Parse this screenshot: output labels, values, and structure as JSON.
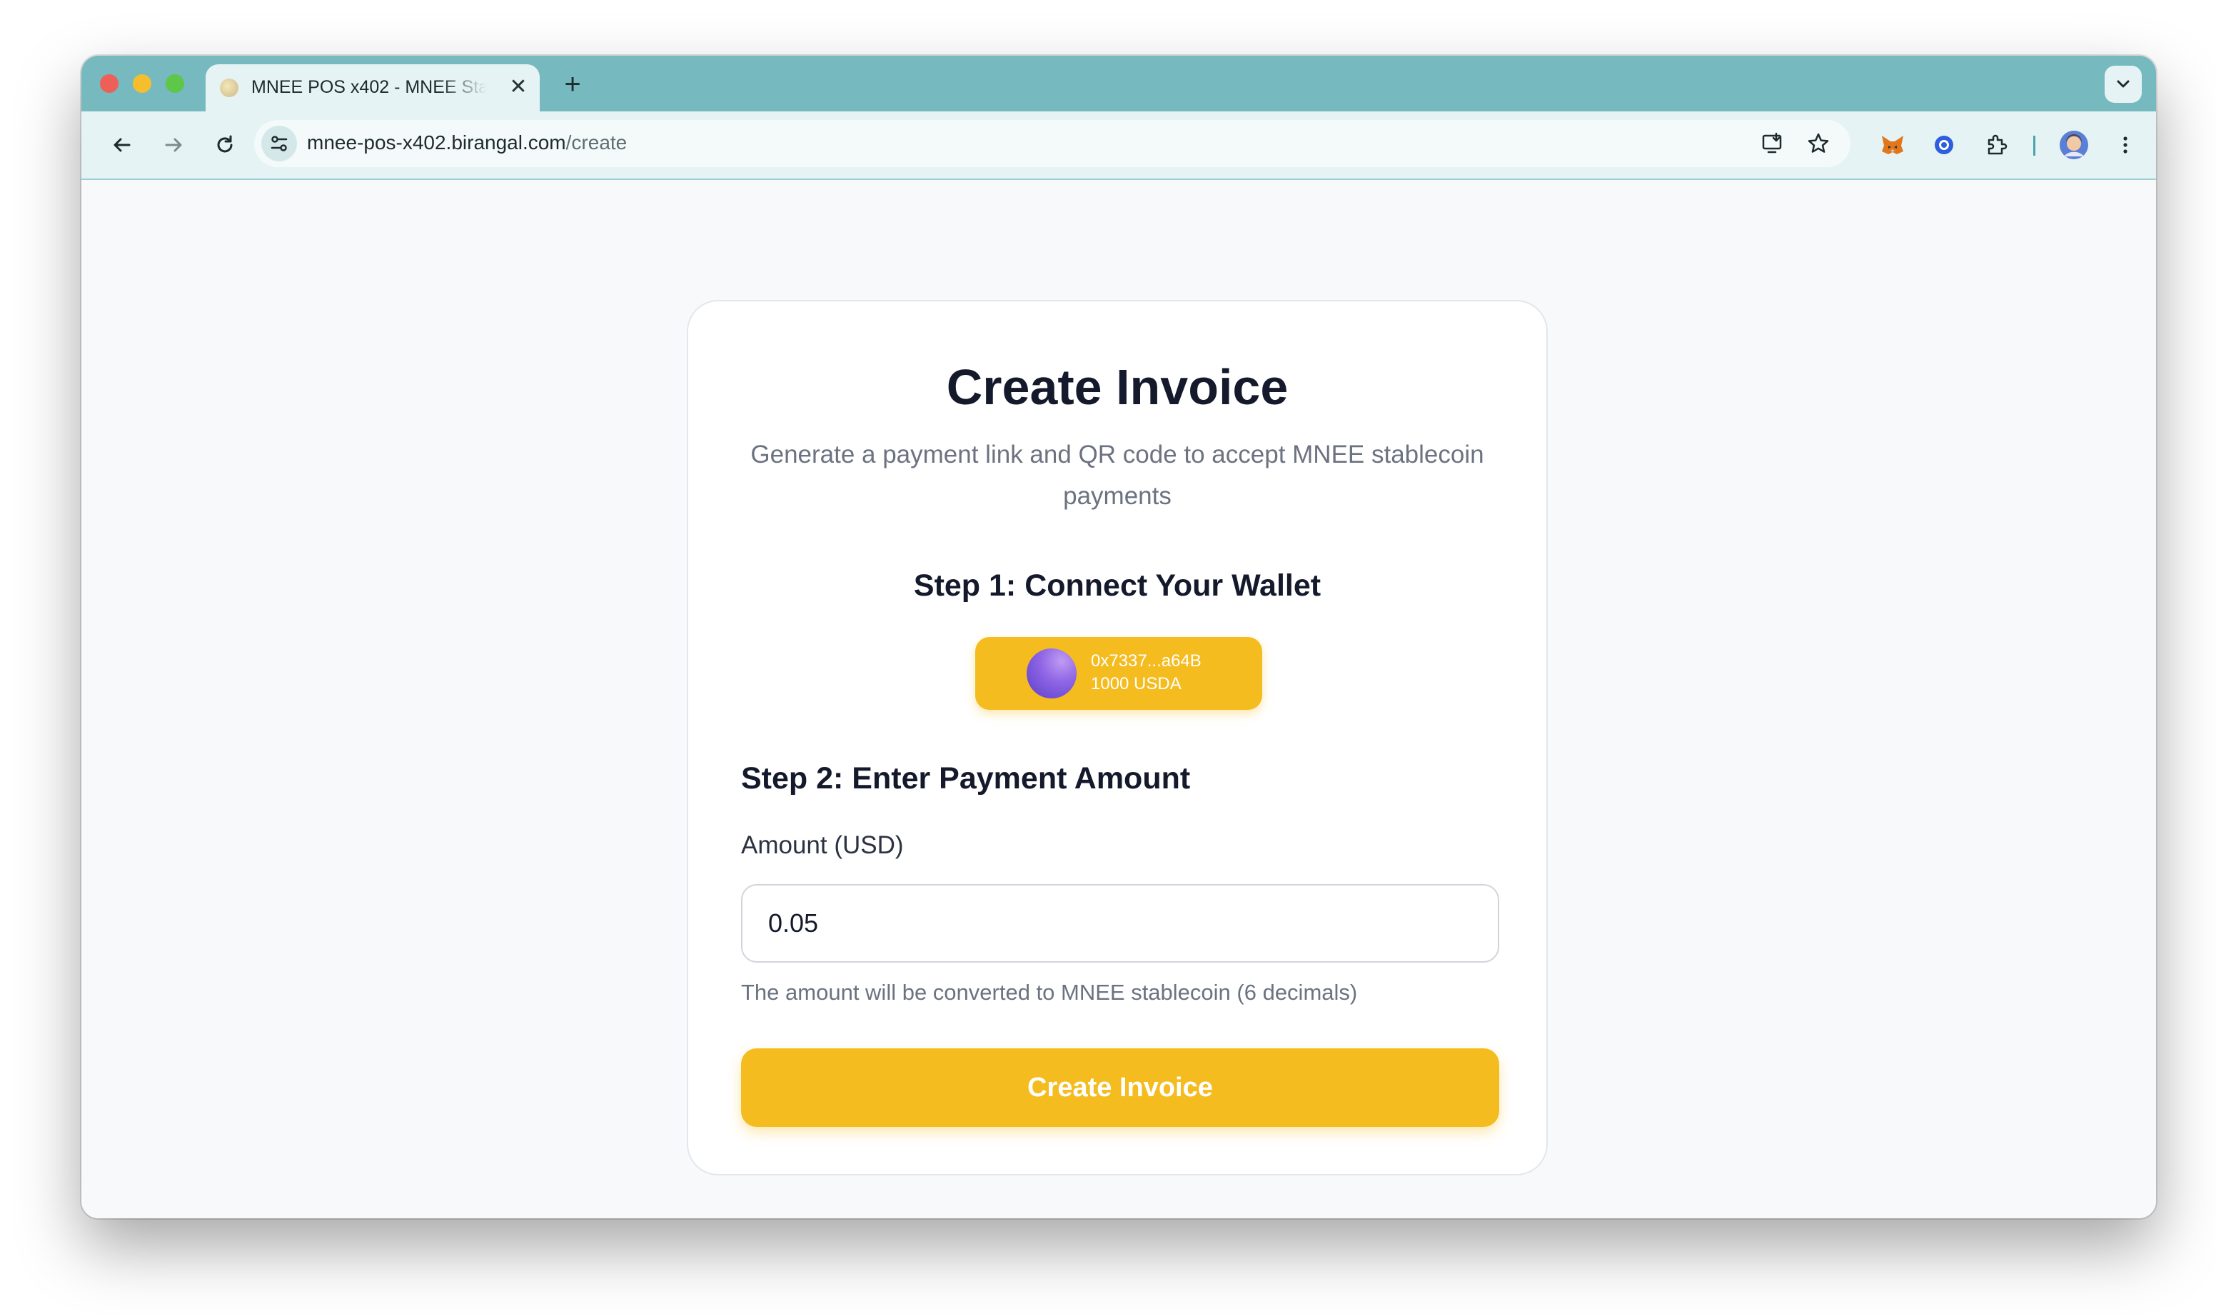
{
  "browser": {
    "tab_title": "MNEE POS x402 - MNEE Stablecoin POS",
    "url_host": "mnee-pos-x402.birangal.com",
    "url_path": "/create",
    "close_glyph": "✕",
    "new_tab_glyph": "+",
    "icons": {
      "back": "arrow-left-icon",
      "forward": "arrow-right-icon",
      "reload": "reload-icon",
      "site_info": "tune-icon",
      "install": "install-app-icon",
      "bookmark": "star-icon",
      "metamask": "metamask-fox-icon",
      "extension2": "ring-extension-icon",
      "extensions": "puzzle-icon",
      "profile": "avatar",
      "menu": "kebab-menu-icon",
      "tab_list": "chevron-down-icon"
    }
  },
  "page": {
    "title": "Create Invoice",
    "subtitle": "Generate a payment link and QR code to accept MNEE stablecoin payments",
    "step1_heading": "Step 1: Connect Your Wallet",
    "wallet": {
      "address": "0x7337...a64B",
      "balance": "1000 USDA"
    },
    "step2_heading": "Step 2: Enter Payment Amount",
    "amount_label": "Amount (USD)",
    "amount_value": "0.05",
    "amount_hint": "The amount will be converted to MNEE stablecoin (6 decimals)",
    "create_button": "Create Invoice"
  },
  "colors": {
    "titlebar": "#76b9be",
    "toolbar": "#e6f3f4",
    "accent": "#f5bc20",
    "heading": "#141a2b",
    "muted": "#6b7280"
  }
}
